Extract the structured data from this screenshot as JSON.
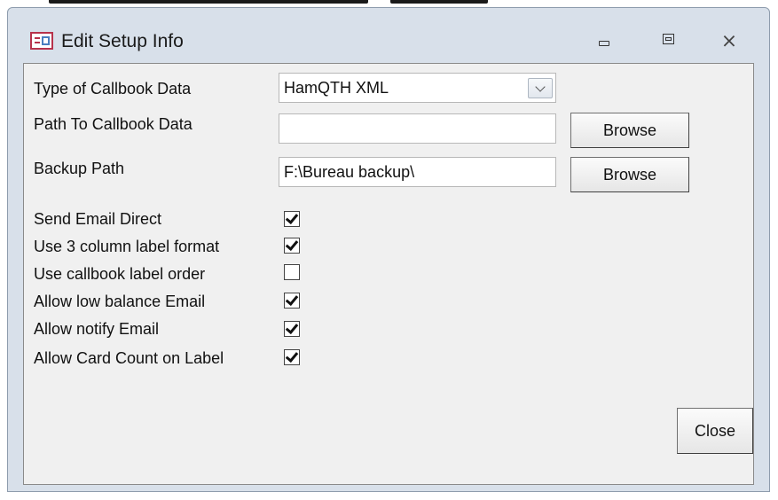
{
  "window": {
    "title": "Edit Setup Info"
  },
  "form": {
    "callbook_type": {
      "label": "Type of Callbook Data",
      "value": "HamQTH XML"
    },
    "callbook_path": {
      "label": "Path To Callbook Data",
      "value": "",
      "browse_label": "Browse"
    },
    "backup_path": {
      "label": "Backup Path",
      "value": "F:\\Bureau backup\\",
      "browse_label": "Browse"
    },
    "options": [
      {
        "label": "Send Email Direct",
        "checked": true
      },
      {
        "label": "Use 3 column label format",
        "checked": true
      },
      {
        "label": "Use callbook label order",
        "checked": false
      },
      {
        "label": "Allow low balance Email",
        "checked": true
      },
      {
        "label": "Allow notify Email",
        "checked": true
      },
      {
        "label": "Allow Card Count on Label",
        "checked": true
      }
    ],
    "close_label": "Close"
  }
}
